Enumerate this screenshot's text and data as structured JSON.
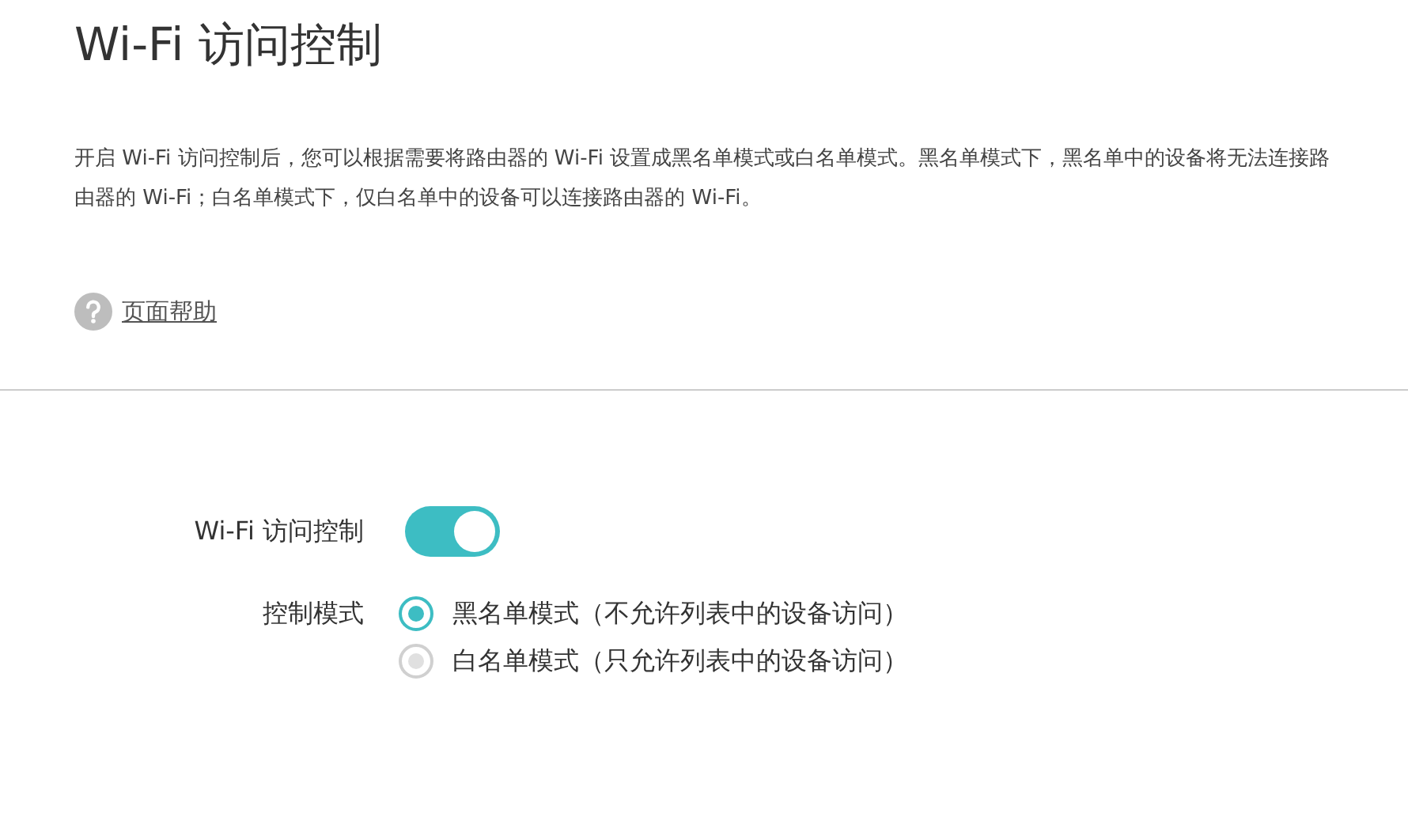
{
  "title": "Wi-Fi 访问控制",
  "description": "开启 Wi-Fi 访问控制后，您可以根据需要将路由器的 Wi-Fi 设置成黑名单模式或白名单模式。黑名单模式下，黑名单中的设备将无法连接路由器的 Wi-Fi；白名单模式下，仅白名单中的设备可以连接路由器的 Wi-Fi。",
  "help_link": {
    "label": "页面帮助"
  },
  "access_control": {
    "label": "Wi-Fi 访问控制",
    "on": true
  },
  "control_mode": {
    "label": "控制模式",
    "options": [
      {
        "label": "黑名单模式（不允许列表中的设备访问）",
        "selected": true
      },
      {
        "label": "白名单模式（只允许列表中的设备访问）",
        "selected": false
      }
    ]
  }
}
